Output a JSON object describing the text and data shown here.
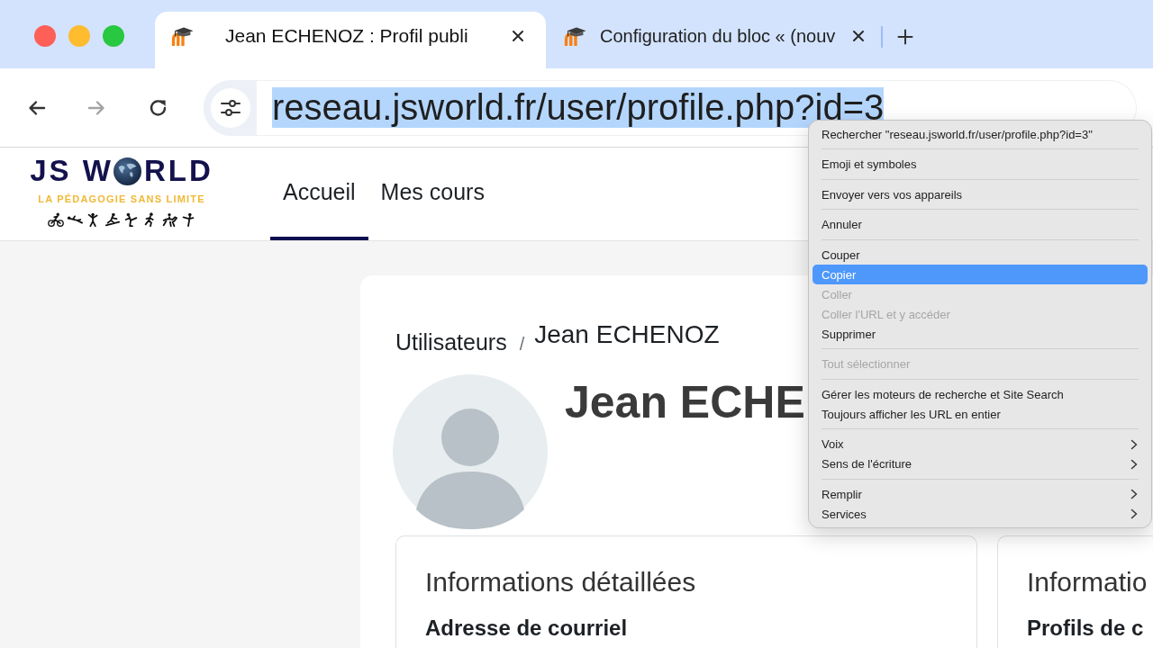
{
  "tabs": [
    {
      "title": "Jean ECHENOZ : Profil publi",
      "selected": true
    },
    {
      "title": "Configuration du bloc « (nouv",
      "selected": false
    }
  ],
  "toolbar": {
    "buttons": [
      {
        "kind": "back",
        "disabled": false
      },
      {
        "kind": "forward",
        "disabled": true
      },
      {
        "kind": "reload",
        "disabled": false
      }
    ],
    "address": {
      "value": "reseau.jsworld.fr/user/profile.php?id=3",
      "selected": true
    }
  },
  "site_header": {
    "logo": {
      "wordmark": [
        "JS W",
        "RLD"
      ],
      "tagline": "LA PÉDAGOGIE SANS LIMITE"
    },
    "nav": [
      {
        "label": "Accueil",
        "selected": true
      },
      {
        "label": "Mes cours",
        "selected": false
      }
    ]
  },
  "page": {
    "breadcrumb": {
      "items": [
        "Utilisateurs",
        "Jean ECHENOZ"
      ],
      "separator": "/"
    },
    "heading": "Jean ECHE",
    "cards": [
      {
        "title": "Informations détaillées",
        "field_label": "Adresse de courriel"
      },
      {
        "title": "Informatio",
        "field_label": "Profils de c"
      }
    ]
  },
  "context_menu": {
    "groups": [
      [
        {
          "label": "Rechercher \"reseau.jsworld.fr/user/profile.php?id=3\"",
          "selected": false,
          "disabled": false,
          "submenu": false
        }
      ],
      [
        {
          "label": "Emoji et symboles",
          "selected": false,
          "disabled": false,
          "submenu": false
        }
      ],
      [
        {
          "label": "Envoyer vers vos appareils",
          "selected": false,
          "disabled": false,
          "submenu": false
        }
      ],
      [
        {
          "label": "Annuler",
          "selected": false,
          "disabled": false,
          "submenu": false
        }
      ],
      [
        {
          "label": "Couper",
          "selected": false,
          "disabled": false,
          "submenu": false
        },
        {
          "label": "Copier",
          "selected": true,
          "disabled": false,
          "submenu": false
        },
        {
          "label": "Coller",
          "selected": false,
          "disabled": true,
          "submenu": false
        },
        {
          "label": "Coller l'URL et y accéder",
          "selected": false,
          "disabled": true,
          "submenu": false
        },
        {
          "label": "Supprimer",
          "selected": false,
          "disabled": false,
          "submenu": false
        }
      ],
      [
        {
          "label": "Tout sélectionner",
          "selected": false,
          "disabled": true,
          "submenu": false
        }
      ],
      [
        {
          "label": "Gérer les moteurs de recherche et Site Search",
          "selected": false,
          "disabled": false,
          "submenu": false
        },
        {
          "label": "Toujours afficher les URL en entier",
          "selected": false,
          "disabled": false,
          "submenu": false
        }
      ],
      [
        {
          "label": "Voix",
          "selected": false,
          "disabled": false,
          "submenu": true
        },
        {
          "label": "Sens de l'écriture",
          "selected": false,
          "disabled": false,
          "submenu": true
        }
      ],
      [
        {
          "label": "Remplir",
          "selected": false,
          "disabled": false,
          "submenu": true
        },
        {
          "label": "Services",
          "selected": false,
          "disabled": false,
          "submenu": true
        }
      ]
    ]
  }
}
